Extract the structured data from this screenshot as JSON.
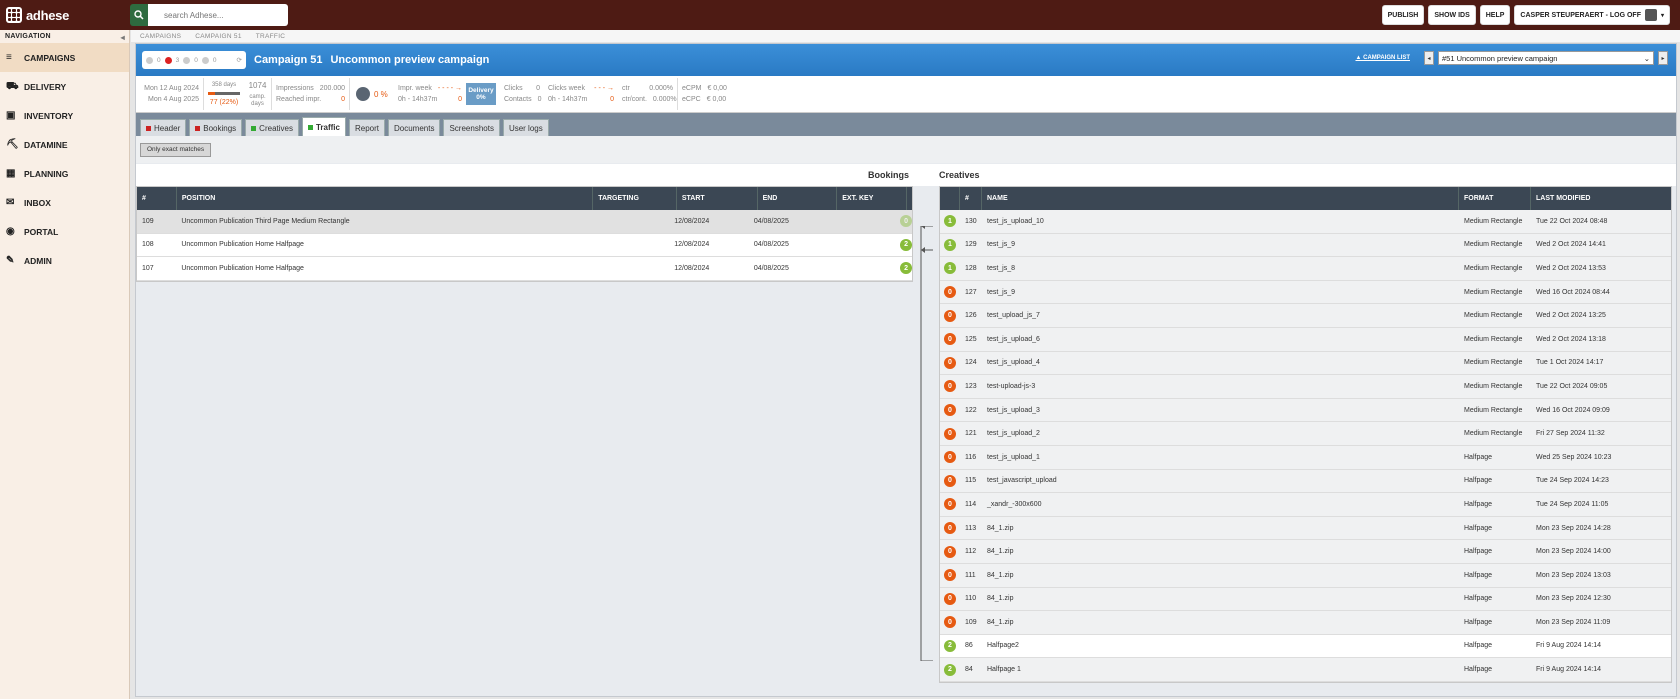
{
  "app": {
    "name": "adhese"
  },
  "search": {
    "placeholder": "search Adhese..."
  },
  "topbar": {
    "buttons": [
      "PUBLISH",
      "SHOW IDS",
      "HELP"
    ],
    "user_label": "CASPER STEUPERAERT - LOG OFF"
  },
  "sidebar": {
    "title": "NAVIGATION",
    "items": [
      {
        "label": "CAMPAIGNS",
        "icon": "campaigns-icon"
      },
      {
        "label": "DELIVERY",
        "icon": "truck-icon"
      },
      {
        "label": "INVENTORY",
        "icon": "briefcase-icon"
      },
      {
        "label": "DATAMINE",
        "icon": "pickaxe-icon"
      },
      {
        "label": "PLANNING",
        "icon": "calendar-icon"
      },
      {
        "label": "INBOX",
        "icon": "mail-icon"
      },
      {
        "label": "PORTAL",
        "icon": "portal-icon"
      },
      {
        "label": "ADMIN",
        "icon": "wrench-icon"
      }
    ]
  },
  "breadcrumb": [
    "CAMPAIGNS",
    "CAMPAIGN 51",
    "TRAFFIC"
  ],
  "campaign": {
    "status_counts": [
      "0",
      "3",
      "0",
      "0"
    ],
    "title": "Campaign 51",
    "name": "Uncommon preview campaign",
    "list_link": "▲ CAMPAIGN LIST",
    "selected": "#51 Uncommon preview campaign"
  },
  "stats": {
    "start": "Mon 12 Aug 2024",
    "end": "Mon 4 Aug 2025",
    "days": "358 days",
    "days_progress": "77 (22%)",
    "camp_days": "1074",
    "camp_days_label": "camp. days",
    "impressions_label": "Impressions",
    "impressions": "200.000",
    "reached_label": "Reached impr.",
    "reached": "0",
    "pct": "0 %",
    "impr_week_label": "Impr. week",
    "impr_week_time": "0h - 14h37m",
    "impr_week_val": "0",
    "delivery_label": "Delivery",
    "delivery_pct": "0%",
    "clicks_label": "Clicks",
    "clicks": "0",
    "contacts_label": "Contacts",
    "contacts": "0",
    "clicks_week_label": "Clicks week",
    "clicks_week_time": "0h - 14h37m",
    "clicks_week_val": "0",
    "ctr_label": "ctr",
    "ctr": "0.000%",
    "ctrcont_label": "ctr/cont.",
    "ctrcont": "0.000%",
    "ecpm_label": "eCPM",
    "ecpm": "€ 0,00",
    "ecpc_label": "eCPC",
    "ecpc": "€ 0,00"
  },
  "tabs": [
    {
      "label": "Header",
      "marker": "red"
    },
    {
      "label": "Bookings",
      "marker": "red"
    },
    {
      "label": "Creatives",
      "marker": "green"
    },
    {
      "label": "Traffic",
      "marker": "green",
      "active": true
    },
    {
      "label": "Report"
    },
    {
      "label": "Documents"
    },
    {
      "label": "Screenshots"
    },
    {
      "label": "User logs"
    }
  ],
  "filter": {
    "label": "Only exact matches"
  },
  "sections": {
    "bookings": "Bookings",
    "creatives": "Creatives"
  },
  "bookings": {
    "columns": [
      "#",
      "POSITION",
      "TARGETING",
      "START",
      "END",
      "EXT. KEY"
    ],
    "rows": [
      {
        "id": "109",
        "position": "Uncommon Publication Third Page Medium Rectangle",
        "targeting": "",
        "start": "12/08/2024",
        "end": "04/08/2025",
        "ext": "",
        "count": "0"
      },
      {
        "id": "108",
        "position": "Uncommon Publication Home Halfpage",
        "targeting": "",
        "start": "12/08/2024",
        "end": "04/08/2025",
        "ext": "",
        "count": "2"
      },
      {
        "id": "107",
        "position": "Uncommon Publication Home Halfpage",
        "targeting": "",
        "start": "12/08/2024",
        "end": "04/08/2025",
        "ext": "",
        "count": "2"
      }
    ]
  },
  "creatives": {
    "columns": [
      "",
      "#",
      "NAME",
      "FORMAT",
      "LAST MODIFIED"
    ],
    "rows": [
      {
        "count": "1",
        "id": "130",
        "name": "test_js_upload_10",
        "format": "Medium Rectangle",
        "modified": "Tue 22 Oct 2024 08:48"
      },
      {
        "count": "1",
        "id": "129",
        "name": "test_js_9",
        "format": "Medium Rectangle",
        "modified": "Wed 2 Oct 2024 14:41"
      },
      {
        "count": "1",
        "id": "128",
        "name": "test_js_8",
        "format": "Medium Rectangle",
        "modified": "Wed 2 Oct 2024 13:53"
      },
      {
        "count": "0",
        "id": "127",
        "name": "test_js_9",
        "format": "Medium Rectangle",
        "modified": "Wed 16 Oct 2024 08:44"
      },
      {
        "count": "0",
        "id": "126",
        "name": "test_upload_js_7",
        "format": "Medium Rectangle",
        "modified": "Wed 2 Oct 2024 13:25"
      },
      {
        "count": "0",
        "id": "125",
        "name": "test_js_upload_6",
        "format": "Medium Rectangle",
        "modified": "Wed 2 Oct 2024 13:18"
      },
      {
        "count": "0",
        "id": "124",
        "name": "test_js_upload_4",
        "format": "Medium Rectangle",
        "modified": "Tue 1 Oct 2024 14:17"
      },
      {
        "count": "0",
        "id": "123",
        "name": "test-upload-js-3",
        "format": "Medium Rectangle",
        "modified": "Tue 22 Oct 2024 09:05"
      },
      {
        "count": "0",
        "id": "122",
        "name": "test_js_upload_3",
        "format": "Medium Rectangle",
        "modified": "Wed 16 Oct 2024 09:09"
      },
      {
        "count": "0",
        "id": "121",
        "name": "test_js_upload_2",
        "format": "Medium Rectangle",
        "modified": "Fri 27 Sep 2024 11:32"
      },
      {
        "count": "0",
        "id": "116",
        "name": "test_js_upload_1",
        "format": "Halfpage",
        "modified": "Wed 25 Sep 2024 10:23"
      },
      {
        "count": "0",
        "id": "115",
        "name": "test_javascript_upload",
        "format": "Halfpage",
        "modified": "Tue 24 Sep 2024 14:23"
      },
      {
        "count": "0",
        "id": "114",
        "name": "_xandr_-300x600",
        "format": "Halfpage",
        "modified": "Tue 24 Sep 2024 11:05"
      },
      {
        "count": "0",
        "id": "113",
        "name": "84_1.zip",
        "format": "Halfpage",
        "modified": "Mon 23 Sep 2024 14:28"
      },
      {
        "count": "0",
        "id": "112",
        "name": "84_1.zip",
        "format": "Halfpage",
        "modified": "Mon 23 Sep 2024 14:00"
      },
      {
        "count": "0",
        "id": "111",
        "name": "84_1.zip",
        "format": "Halfpage",
        "modified": "Mon 23 Sep 2024 13:03"
      },
      {
        "count": "0",
        "id": "110",
        "name": "84_1.zip",
        "format": "Halfpage",
        "modified": "Mon 23 Sep 2024 12:30"
      },
      {
        "count": "0",
        "id": "109",
        "name": "84_1.zip",
        "format": "Halfpage",
        "modified": "Mon 23 Sep 2024 11:09"
      },
      {
        "count": "2",
        "id": "86",
        "name": "Halfpage2",
        "format": "Halfpage",
        "modified": "Fri 9 Aug 2024 14:14"
      },
      {
        "count": "2",
        "id": "84",
        "name": "Halfpage 1",
        "format": "Halfpage",
        "modified": "Fri 9 Aug 2024 14:14"
      }
    ]
  }
}
